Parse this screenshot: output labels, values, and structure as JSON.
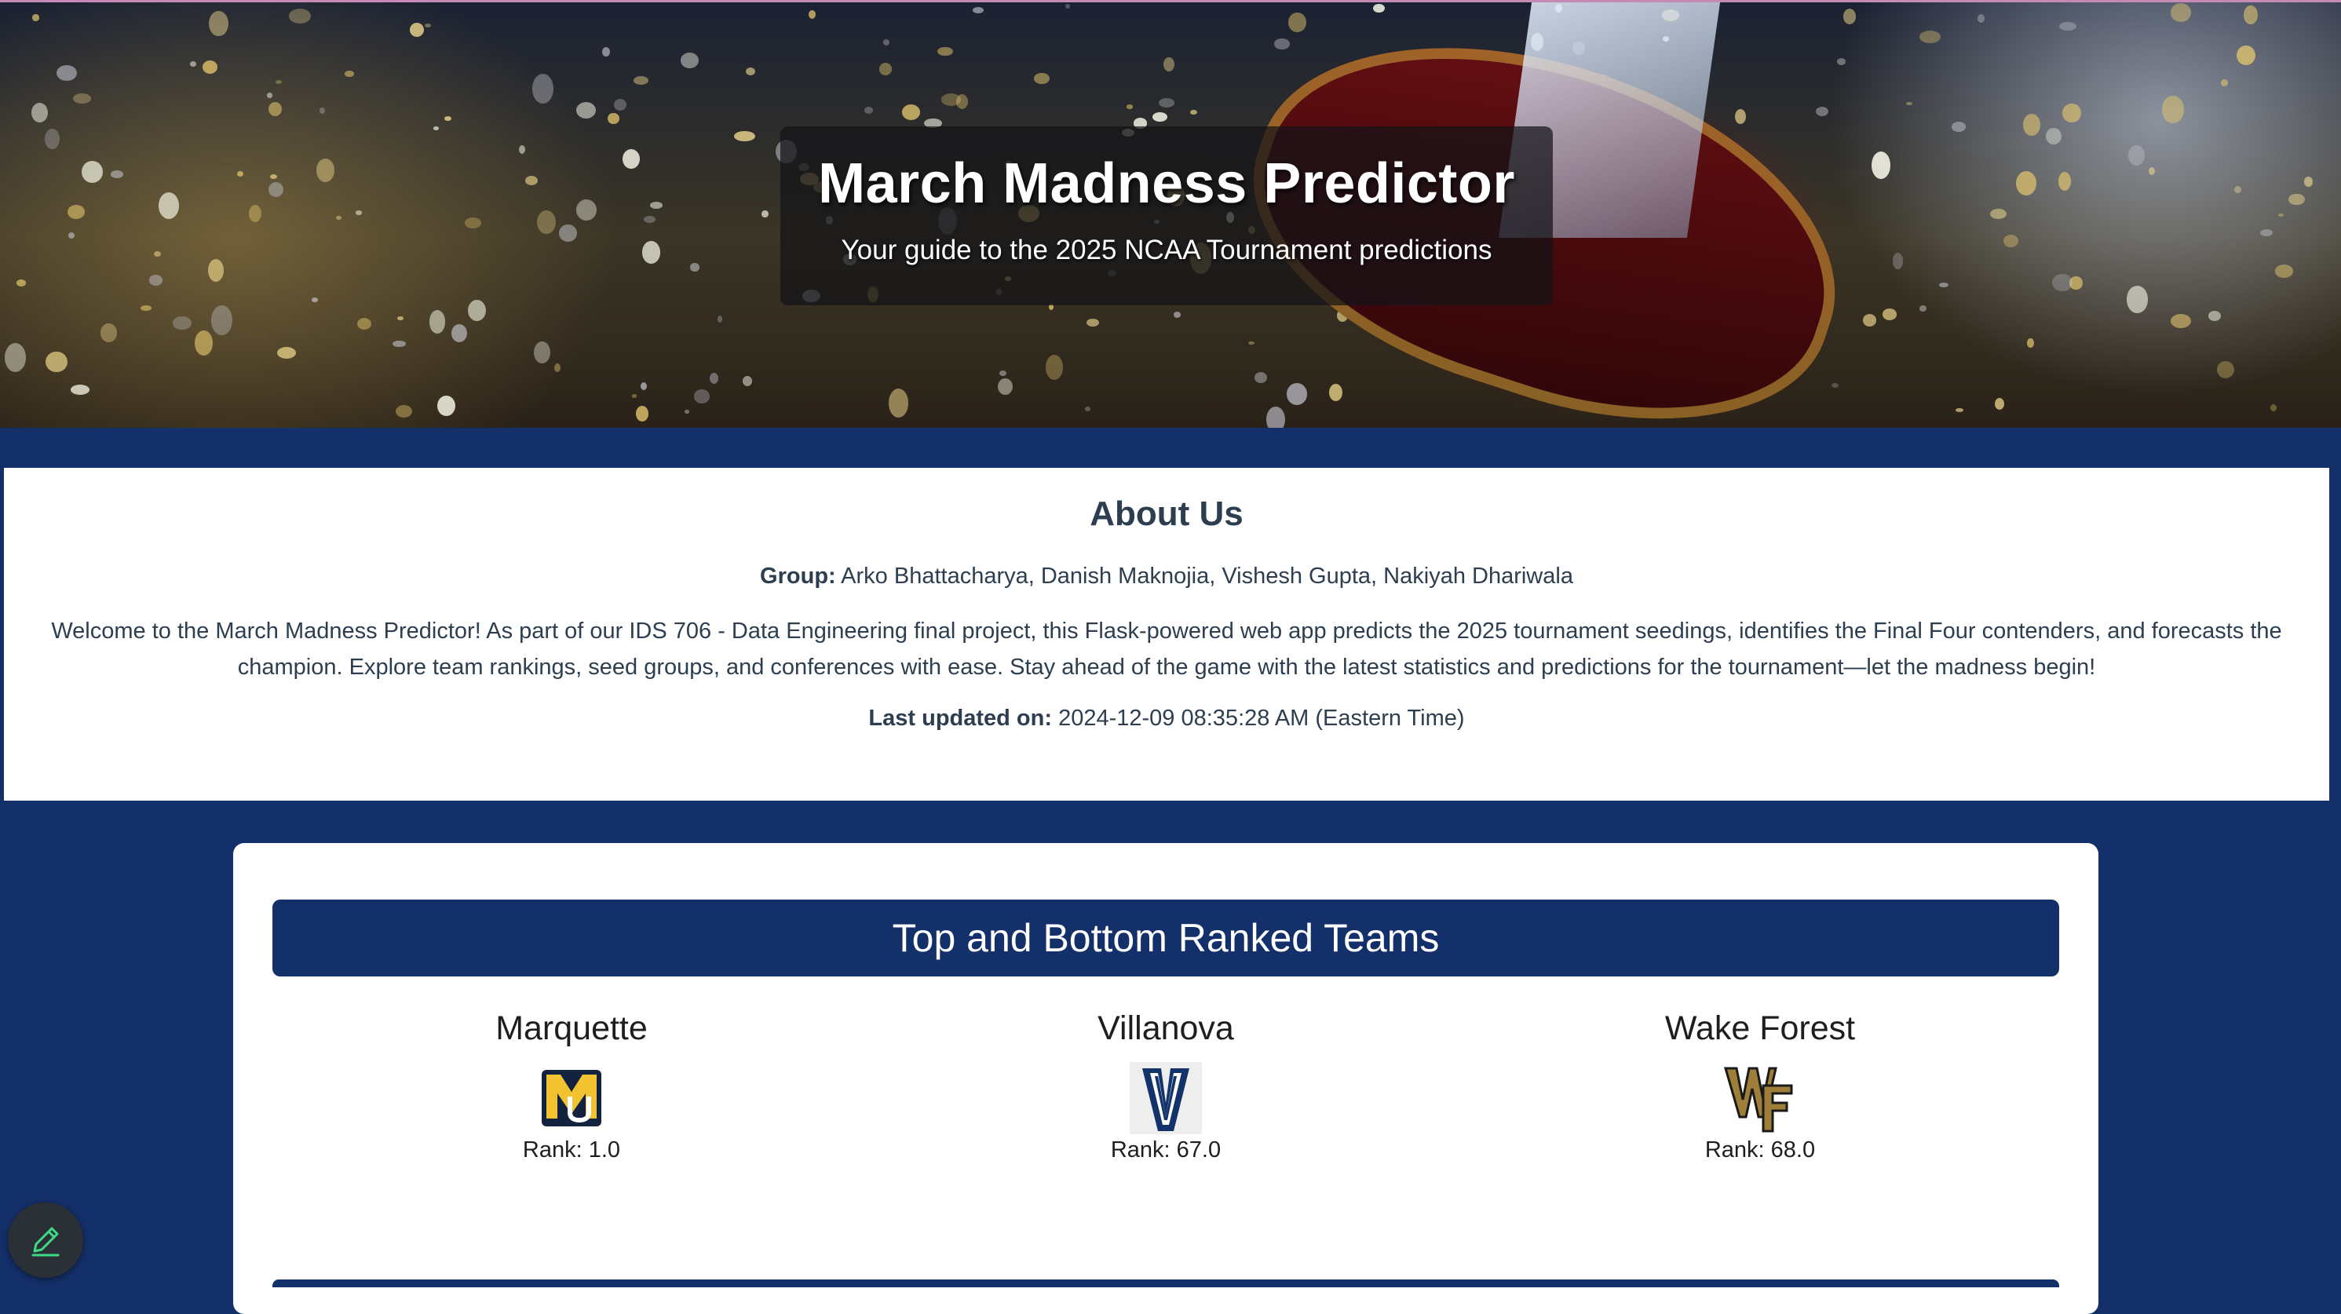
{
  "hero": {
    "title": "March Madness Predictor",
    "subtitle": "Your guide to the 2025 NCAA Tournament predictions"
  },
  "about": {
    "heading": "About Us",
    "group_label": "Group:",
    "group_members": "Arko Bhattacharya, Danish Maknojia, Vishesh Gupta, Nakiyah Dhariwala",
    "description": "Welcome to the March Madness Predictor! As part of our IDS 706 - Data Engineering final project, this Flask-powered web app predicts the 2025 tournament seedings, identifies the Final Four contenders, and forecasts the champion. Explore team rankings, seed groups, and conferences with ease. Stay ahead of the game with the latest statistics and predictions for the tournament—let the madness begin!",
    "updated_label": "Last updated on:",
    "updated_value": "2024-12-09 08:35:28 AM (Eastern Time)"
  },
  "ranked": {
    "heading": "Top and Bottom Ranked Teams",
    "teams": [
      {
        "name": "Marquette",
        "rank_text": "Rank: 1.0",
        "logo_icon": "marquette-logo-icon"
      },
      {
        "name": "Villanova",
        "rank_text": "Rank: 67.0",
        "logo_icon": "villanova-logo-icon"
      },
      {
        "name": "Wake Forest",
        "rank_text": "Rank: 68.0",
        "logo_icon": "wake-forest-logo-icon"
      }
    ]
  },
  "colors": {
    "navy": "#14306a",
    "text_dark": "#2d3e50",
    "marquette_gold": "#f2c230",
    "villanova_navy": "#13336b",
    "wake_gold": "#9e7e38"
  },
  "fab": {
    "icon": "pencil-icon"
  }
}
